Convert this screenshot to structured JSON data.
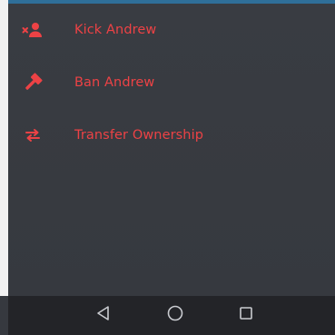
{
  "menu": {
    "items": [
      {
        "label": "Kick Andrew",
        "icon": "kick-user-icon"
      },
      {
        "label": "Ban Andrew",
        "icon": "ban-hammer-icon"
      },
      {
        "label": "Transfer Ownership",
        "icon": "transfer-arrows-icon"
      }
    ]
  },
  "colors": {
    "danger": "#ed4245",
    "panel": "#36393f",
    "navbar": "#232428",
    "nav_icon": "#c9cbd0"
  },
  "navbar": {
    "buttons": [
      "back-icon",
      "home-icon",
      "recents-icon"
    ]
  }
}
